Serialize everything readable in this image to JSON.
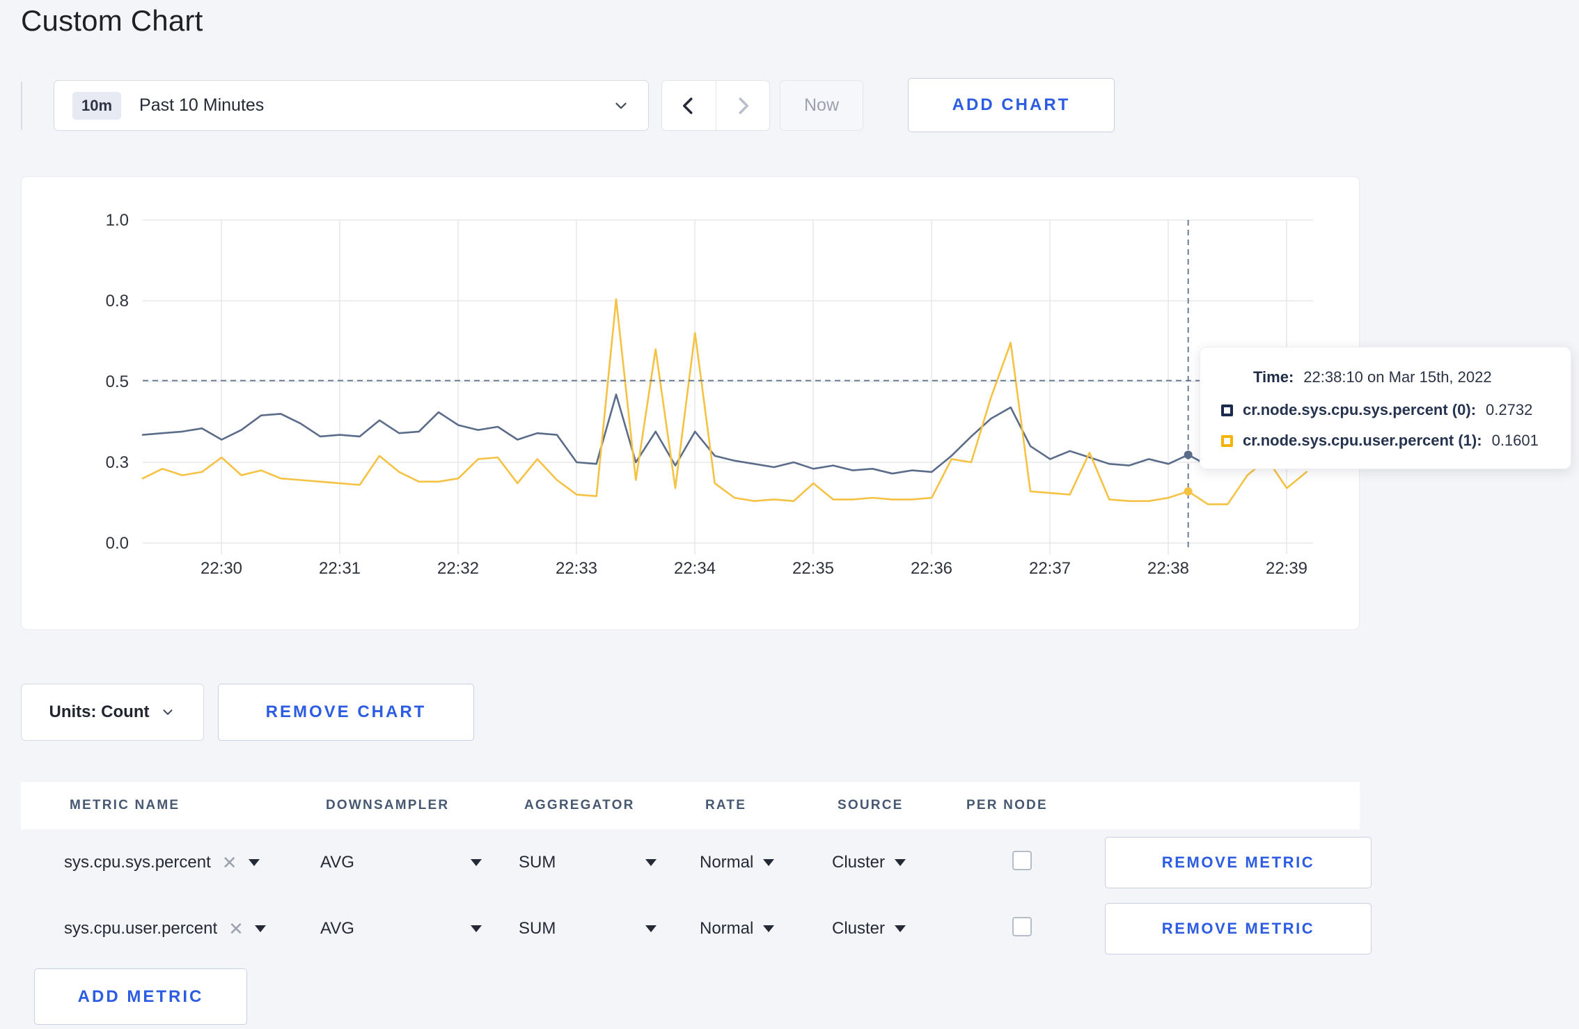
{
  "page": {
    "title": "Custom Chart"
  },
  "toolbar": {
    "time_range": {
      "badge": "10m",
      "label": "Past 10 Minutes",
      "dropdown_icon": "chevron-down"
    },
    "prev_icon": "chevron-left",
    "next_icon": "chevron-right",
    "now_label": "Now",
    "add_chart_label": "ADD CHART"
  },
  "tooltip": {
    "time_label": "Time:",
    "time_value": "22:38:10 on Mar 15th, 2022",
    "entries": [
      {
        "name": "cr.node.sys.cpu.sys.percent (0):",
        "value": "0.2732",
        "color": "#1b2b4e"
      },
      {
        "name": "cr.node.sys.cpu.user.percent (1):",
        "value": "0.1601",
        "color": "#f5b301"
      }
    ]
  },
  "chart_data": {
    "type": "line",
    "title": "",
    "xlabel": "",
    "ylabel": "",
    "ylim": [
      0,
      1
    ],
    "grid": true,
    "x_start": "22:29:20",
    "x_interval_seconds": 10,
    "x_ticks": [
      "22:30",
      "22:31",
      "22:32",
      "22:33",
      "22:34",
      "22:35",
      "22:36",
      "22:37",
      "22:38",
      "22:39"
    ],
    "y_ticks": [
      {
        "value": 0.0,
        "label": "0.0"
      },
      {
        "value": 0.25,
        "label": "0.3"
      },
      {
        "value": 0.5,
        "label": "0.5"
      },
      {
        "value": 0.75,
        "label": "0.8"
      },
      {
        "value": 1.0,
        "label": "1.0"
      }
    ],
    "series": [
      {
        "name": "cr.node.sys.cpu.sys.percent",
        "color": "#5b6b8a",
        "values": [
          0.335,
          0.34,
          0.345,
          0.355,
          0.32,
          0.35,
          0.395,
          0.4,
          0.37,
          0.33,
          0.335,
          0.33,
          0.38,
          0.34,
          0.345,
          0.405,
          0.365,
          0.35,
          0.36,
          0.32,
          0.34,
          0.335,
          0.25,
          0.245,
          0.46,
          0.25,
          0.345,
          0.24,
          0.345,
          0.27,
          0.255,
          0.245,
          0.235,
          0.25,
          0.23,
          0.24,
          0.225,
          0.23,
          0.215,
          0.225,
          0.22,
          0.27,
          0.33,
          0.385,
          0.42,
          0.3,
          0.26,
          0.285,
          0.265,
          0.245,
          0.24,
          0.26,
          0.245,
          0.2732,
          0.24,
          0.255,
          0.265,
          0.25,
          0.245,
          0.255
        ]
      },
      {
        "name": "cr.node.sys.cpu.user.percent",
        "color": "#f6c244",
        "values": [
          0.2,
          0.23,
          0.21,
          0.22,
          0.265,
          0.21,
          0.225,
          0.2,
          0.195,
          0.19,
          0.185,
          0.18,
          0.27,
          0.22,
          0.19,
          0.19,
          0.2,
          0.26,
          0.265,
          0.185,
          0.26,
          0.195,
          0.15,
          0.145,
          0.755,
          0.195,
          0.6,
          0.17,
          0.65,
          0.185,
          0.14,
          0.13,
          0.135,
          0.13,
          0.185,
          0.135,
          0.135,
          0.14,
          0.135,
          0.135,
          0.14,
          0.26,
          0.25,
          0.45,
          0.62,
          0.16,
          0.155,
          0.15,
          0.28,
          0.135,
          0.13,
          0.13,
          0.14,
          0.1601,
          0.12,
          0.12,
          0.21,
          0.26,
          0.17,
          0.22
        ]
      }
    ],
    "crosshair": {
      "time": "22:38:10",
      "x_index": 53,
      "y_value": 0.503,
      "points": [
        {
          "series": 0,
          "value": 0.2732
        },
        {
          "series": 1,
          "value": 0.1601
        }
      ]
    }
  },
  "units_bar": {
    "units_label": "Units: Count",
    "remove_chart_label": "REMOVE CHART"
  },
  "metrics_table": {
    "headers": [
      "METRIC NAME",
      "DOWNSAMPLER",
      "AGGREGATOR",
      "RATE",
      "SOURCE",
      "PER NODE"
    ],
    "rows": [
      {
        "name": "sys.cpu.sys.percent",
        "clear_icon": "close-x",
        "downsampler": "AVG",
        "aggregator": "SUM",
        "rate": "Normal",
        "source": "Cluster",
        "per_node_checked": false,
        "remove_label": "REMOVE METRIC"
      },
      {
        "name": "sys.cpu.user.percent",
        "clear_icon": "close-x",
        "downsampler": "AVG",
        "aggregator": "SUM",
        "rate": "Normal",
        "source": "Cluster",
        "per_node_checked": false,
        "remove_label": "REMOVE METRIC"
      }
    ],
    "add_metric_label": "ADD METRIC"
  }
}
